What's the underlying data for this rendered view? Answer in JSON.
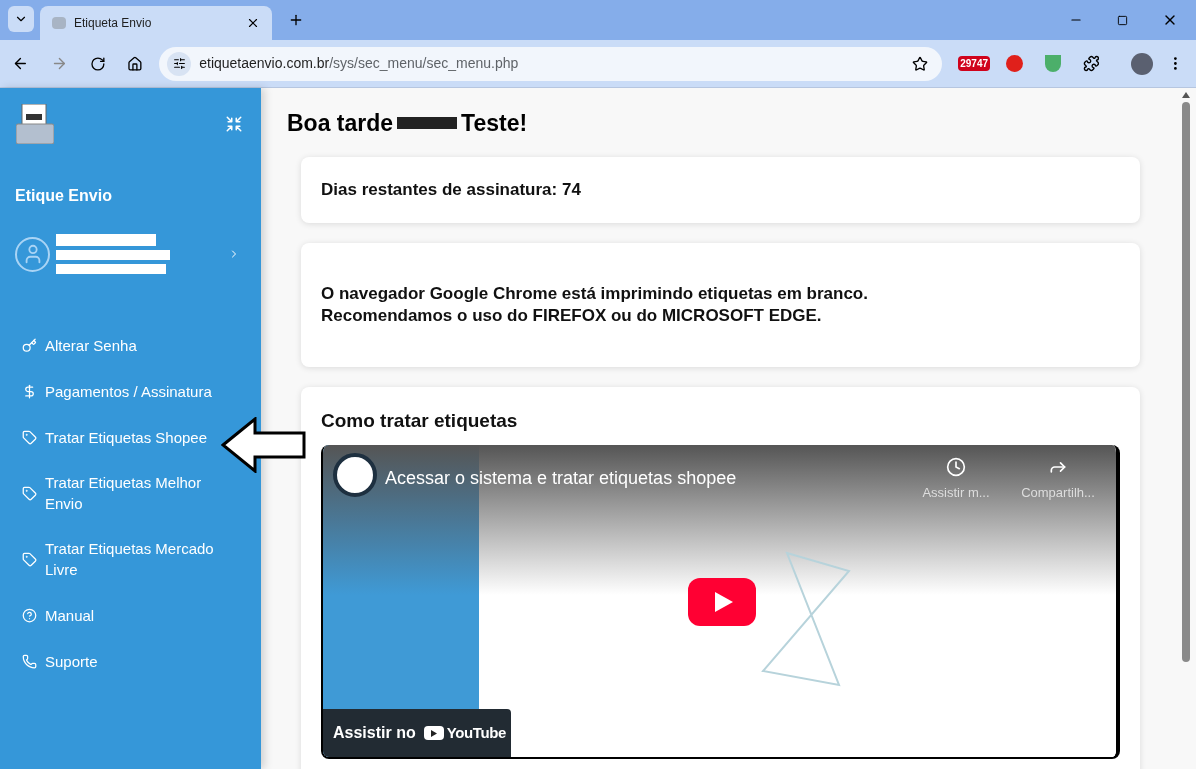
{
  "browser": {
    "tab_title": "Etiqueta Envio",
    "url_host": "etiquetaenvio.com.br",
    "url_path": "/sys/sec_menu/sec_menu.php",
    "extension_badge": "29747"
  },
  "sidebar": {
    "brand": "Etique Envio",
    "items": [
      {
        "label": "Alterar Senha",
        "kind": "key"
      },
      {
        "label": "Pagamentos / Assinatura",
        "kind": "dollar"
      },
      {
        "label": "Tratar Etiquetas Shopee",
        "kind": "label"
      },
      {
        "label": "Tratar Etiquetas Melhor Envio",
        "kind": "label"
      },
      {
        "label": "Tratar Etiquetas Mercado Livre",
        "kind": "label"
      },
      {
        "label": "Manual",
        "kind": "help"
      },
      {
        "label": "Suporte",
        "kind": "whatsapp"
      }
    ]
  },
  "greeting": {
    "start": "Boa tarde",
    "end": "Teste!"
  },
  "cards": [
    {
      "text": "Dias restantes de assinatura: 74"
    },
    {
      "text": "O navegador Google Chrome está imprimindo etiquetas em branco. Recomendamos o uso do FIREFOX ou do MICROSOFT EDGE."
    }
  ],
  "video_section": {
    "title": "Como tratar etiquetas",
    "video_title": "Acessar o sistema e tratar etiquetas shopee",
    "actions": [
      "Assistir m...",
      "Compartilh..."
    ],
    "watch_on": "Assistir no",
    "platform": "YouTube"
  }
}
